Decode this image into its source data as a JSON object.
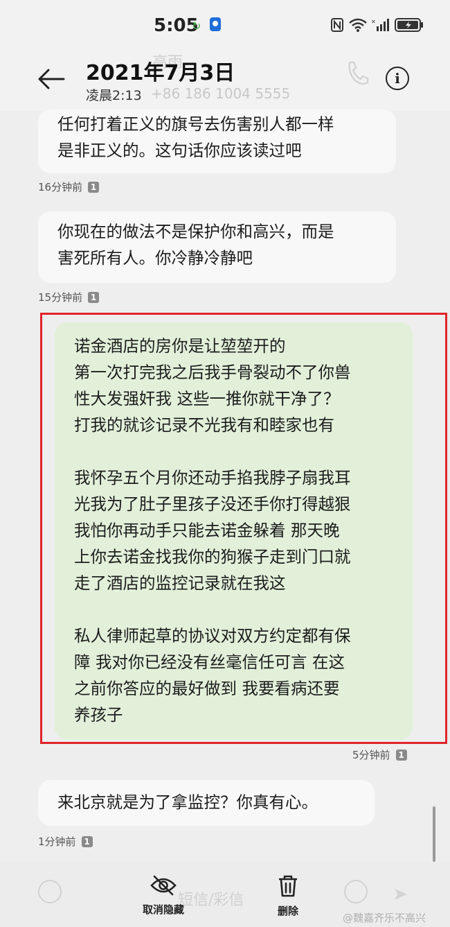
{
  "status_bar": {
    "time": "5:05",
    "icons": [
      "sync-icon",
      "app-shield-icon",
      "nfc-icon",
      "wifi-icon",
      "signal-icon",
      "battery-charging-icon"
    ]
  },
  "header": {
    "title": "2021年7月3日",
    "subtitle": "凌晨2:13",
    "ghost_name": "高雨",
    "ghost_phone": "+86 186 1004 5555",
    "icons": [
      "back-arrow-icon",
      "phone-call-icon",
      "info-icon"
    ]
  },
  "messages": [
    {
      "direction": "received",
      "lines": [
        "任何打着正义的旗号去伤害别人都一样",
        "是非正义的。这句话你应该读过吧"
      ],
      "time": "16分钟前",
      "sim": "1"
    },
    {
      "direction": "received",
      "lines": [
        "你现在的做法不是保护你和高兴，而是",
        "害死所有人。你冷静冷静吧"
      ],
      "time": "15分钟前",
      "sim": "1"
    },
    {
      "direction": "sent",
      "highlighted": true,
      "lines": [
        "诺金酒店的房你是让堃堃开的",
        "第一次打完我之后我手骨裂动不了你兽",
        "性大发强奸我 这些一推你就干净了？",
        "打我的就诊记录不光我有和睦家也有",
        "",
        "我怀孕五个月你还动手掐我脖子扇我耳",
        "光我为了肚子里孩子没还手你打得越狠",
        "我怕你再动手只能去诺金躲着 那天晚",
        "上你去诺金找我你的狗猴子走到门口就",
        "走了酒店的监控记录就在我这",
        "",
        "私人律师起草的协议对双方约定都有保",
        "障 我对你已经没有丝毫信任可言 在这",
        "之前你答应的最好做到 我要看病还要",
        "养孩子"
      ],
      "time": "5分钟前",
      "sim": "1"
    },
    {
      "direction": "received",
      "lines": [
        "来北京就是为了拿监控？你真有心。"
      ],
      "time": "1分钟前",
      "sim": "1"
    }
  ],
  "bottom_bar": {
    "input_placeholder": "短信/彩信",
    "actions": [
      {
        "label": "取消隐藏",
        "icon": "eye-slash-icon"
      },
      {
        "label": "删除",
        "icon": "trash-icon"
      }
    ]
  },
  "watermark": "@魏嘉齐乐不高兴",
  "colors": {
    "sent_bubble": "#e2f0da",
    "received_bubble": "#f8f8f8",
    "highlight_border": "#e0242a",
    "background": "#eeeeee"
  }
}
